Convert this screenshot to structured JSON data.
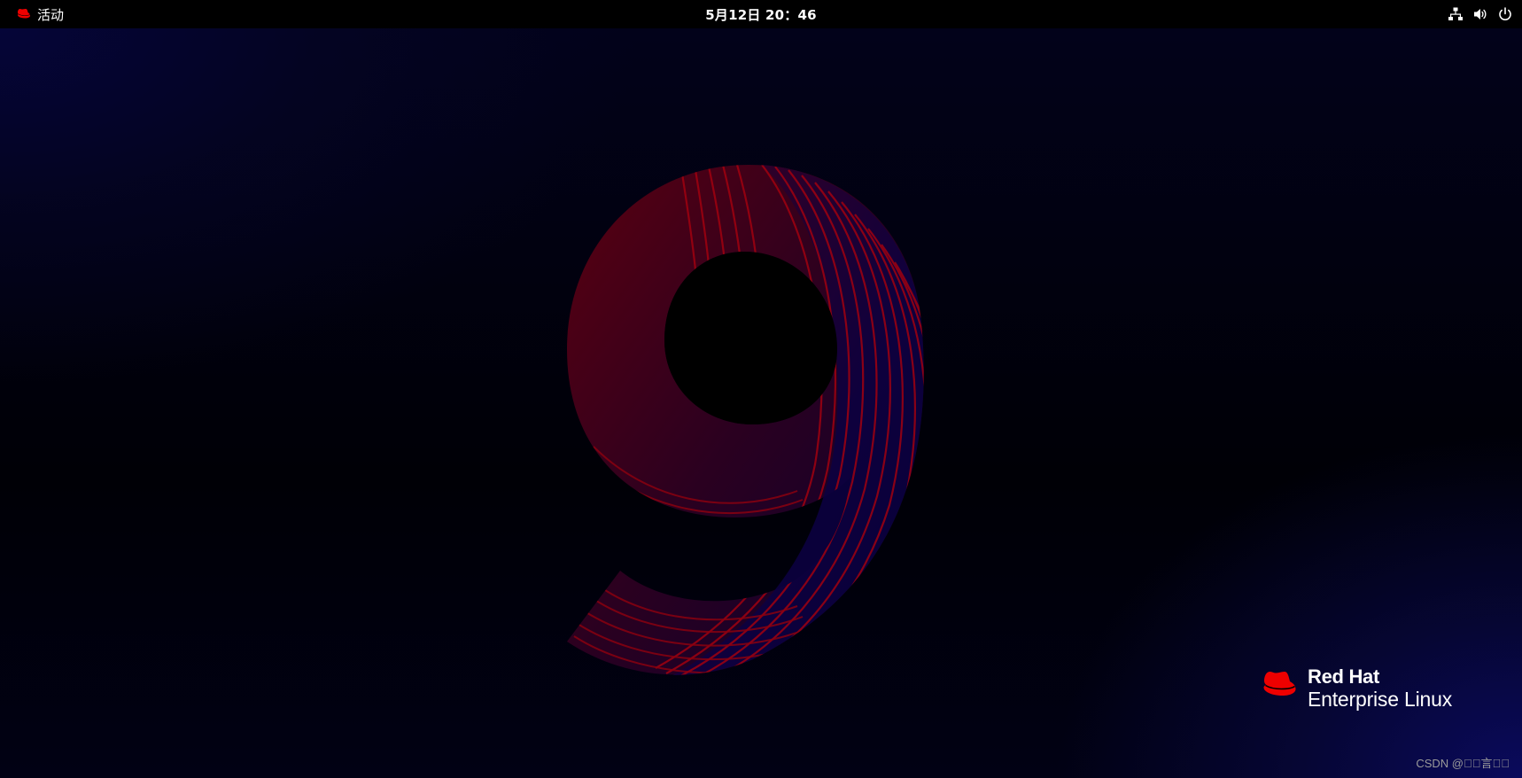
{
  "topbar": {
    "activities_label": "活动",
    "activities_icon": "redhat-hat-icon",
    "clock_text": "5月12日 20：46",
    "tray_icons": [
      "network-wired-icon",
      "volume-icon",
      "power-icon"
    ]
  },
  "wallpaper": {
    "graphic": "9",
    "brand_line1": "Red Hat",
    "brand_line2": "Enterprise Linux",
    "brand_icon": "redhat-hat-icon",
    "accent_color": "#ee0000"
  },
  "watermark": {
    "text": "CSDN @\u0000\u0000言\u0000\u0000"
  }
}
